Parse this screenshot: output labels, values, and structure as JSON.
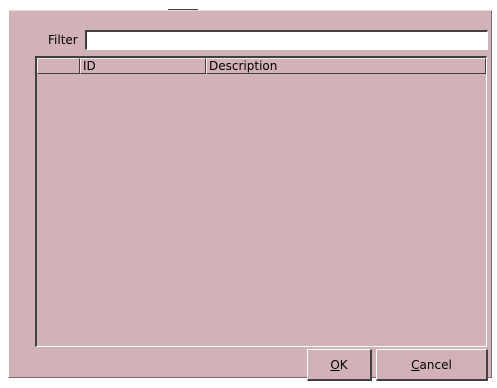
{
  "filter": {
    "label": "Filter",
    "value": ""
  },
  "table": {
    "columns": [
      {
        "label": ""
      },
      {
        "label": "ID"
      },
      {
        "label": "Description"
      }
    ],
    "rows": []
  },
  "buttons": {
    "ok": {
      "mnemonic": "O",
      "rest": "K"
    },
    "cancel": {
      "mnemonic": "C",
      "rest": "ancel"
    }
  },
  "colors": {
    "panel_background": "#d2b1b8",
    "dialog_background": "#ffffff",
    "input_background": "#ffffff"
  }
}
